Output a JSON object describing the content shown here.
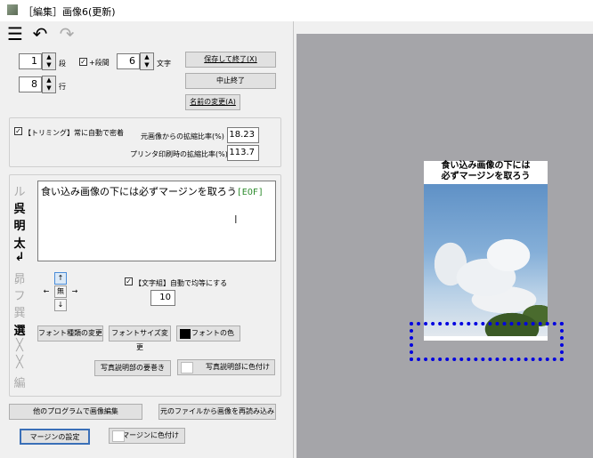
{
  "window": {
    "title": "［編集］画像6(更新)"
  },
  "toolbar": {
    "menu_icon": "☰",
    "undo_icon": "↶",
    "redo_icon": "↷"
  },
  "layout": {
    "columns_value": "1",
    "columns_label": "段",
    "plus_columns_checked": true,
    "plus_columns_label": "+段間",
    "chars_value": "6",
    "chars_label": "文字",
    "rows_value": "8",
    "rows_label": "行"
  },
  "buttons": {
    "save_exit": "保存して終了(X)",
    "cancel_exit": "中止終了",
    "rename": "名前の変更(A)",
    "font_type": "フォント種類の変更",
    "font_size": "フォントサイズ変更",
    "font_color": "フォントの色",
    "caption_position": "写真説明部の要巻き",
    "caption_color": "写真説明部に色付け",
    "edit_other": "他のプログラムで画像編集",
    "reload": "元のファイルから画像を再読み込み",
    "margin_setting": "マージンの設定",
    "margin_color": "マージンに色付け"
  },
  "trimming": {
    "checked": true,
    "label": "【トリミング】常に自動で密着",
    "scale_label": "元画像からの拡縮比率(%)",
    "scale_value": "18.23",
    "print_label": "プリンタ印刷時の拡縮比率(%)",
    "print_value": "113.7"
  },
  "caption": {
    "text": "食い込み画像の下には必ずマージンを取ろう",
    "eof": "[EOF]",
    "equalize_checked": true,
    "equalize_label": "【文字組】自動で均等にする",
    "equalize_value": "10"
  },
  "side_glyphs": [
    "ル",
    "呉",
    "明",
    "太",
    "↲",
    "昴",
    "フ",
    "巽",
    "選",
    "╳",
    "╳",
    "編"
  ],
  "arrows": {
    "up": "↑",
    "left": "←",
    "center": "無",
    "right": "→",
    "down": "↓"
  },
  "preview": {
    "line1": "食い込み画像の下には",
    "line2": "必ずマージンを取ろう"
  }
}
